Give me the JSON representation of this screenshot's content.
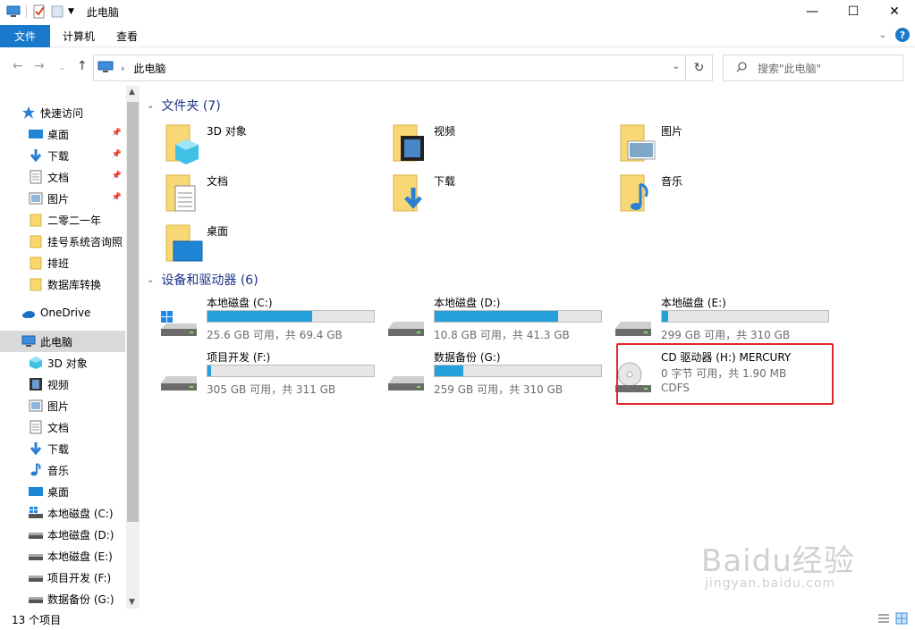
{
  "window": {
    "title": "此电脑",
    "controls": [
      "minimize-icon",
      "maximize-icon",
      "close-icon"
    ]
  },
  "ribbon": {
    "tabs": [
      {
        "label": "文件",
        "active": true
      },
      {
        "label": "计算机"
      },
      {
        "label": "查看"
      }
    ],
    "help": "?"
  },
  "address": {
    "crumb": "此电脑",
    "search_placeholder": "搜索\"此电脑\""
  },
  "sidebar": {
    "quick_access": "快速访问",
    "pinned": [
      {
        "label": "桌面",
        "icon": "desktop-icon"
      },
      {
        "label": "下载",
        "icon": "download-icon"
      },
      {
        "label": "文档",
        "icon": "document-icon"
      },
      {
        "label": "图片",
        "icon": "picture-icon"
      }
    ],
    "recent": [
      {
        "label": "二零二一年",
        "icon": "folder-icon"
      },
      {
        "label": "挂号系统咨询照",
        "icon": "folder-icon"
      },
      {
        "label": "排班",
        "icon": "folder-icon"
      },
      {
        "label": "数据库转换",
        "icon": "folder-icon"
      }
    ],
    "onedrive": "OneDrive",
    "this_pc": "此电脑",
    "pc_items": [
      {
        "label": "3D 对象",
        "icon": "3d-objects-icon"
      },
      {
        "label": "视频",
        "icon": "video-icon"
      },
      {
        "label": "图片",
        "icon": "picture-icon"
      },
      {
        "label": "文档",
        "icon": "document-icon"
      },
      {
        "label": "下载",
        "icon": "download-icon"
      },
      {
        "label": "音乐",
        "icon": "music-icon"
      },
      {
        "label": "桌面",
        "icon": "desktop-icon"
      },
      {
        "label": "本地磁盘 (C:)",
        "icon": "windows-drive-icon"
      },
      {
        "label": "本地磁盘 (D:)",
        "icon": "drive-icon"
      },
      {
        "label": "本地磁盘 (E:)",
        "icon": "drive-icon"
      },
      {
        "label": "项目开发 (F:)",
        "icon": "drive-icon"
      },
      {
        "label": "数据备份 (G:)",
        "icon": "drive-icon"
      }
    ]
  },
  "folders_group": {
    "title": "文件夹 (7)",
    "items": [
      {
        "label": "3D 对象",
        "icon": "3d-objects-folder-icon"
      },
      {
        "label": "视频",
        "icon": "video-folder-icon"
      },
      {
        "label": "图片",
        "icon": "picture-folder-icon"
      },
      {
        "label": "文档",
        "icon": "document-folder-icon"
      },
      {
        "label": "下载",
        "icon": "download-folder-icon"
      },
      {
        "label": "音乐",
        "icon": "music-folder-icon"
      },
      {
        "label": "桌面",
        "icon": "desktop-folder-icon"
      }
    ]
  },
  "drives_group": {
    "title": "设备和驱动器 (6)",
    "items": [
      {
        "label": "本地磁盘 (C:)",
        "size": "25.6 GB 可用，共 69.4 GB",
        "used_fraction": 0.63
      },
      {
        "label": "本地磁盘 (D:)",
        "size": "10.8 GB 可用，共 41.3 GB",
        "used_fraction": 0.74
      },
      {
        "label": "本地磁盘 (E:)",
        "size": "299 GB 可用，共 310 GB",
        "used_fraction": 0.035
      },
      {
        "label": "项目开发 (F:)",
        "size": "305 GB 可用，共 311 GB",
        "used_fraction": 0.02
      },
      {
        "label": "数据备份 (G:)",
        "size": "259 GB 可用，共 310 GB",
        "used_fraction": 0.17
      },
      {
        "label": "CD 驱动器 (H:) MERCURY",
        "size": "0 字节 可用，共 1.90 MB",
        "fs": "CDFS"
      }
    ]
  },
  "status": {
    "count": "13 个项目"
  },
  "watermark": {
    "brand": "Baidu经验",
    "url": "jingyan.baidu.com"
  },
  "colors": {
    "accent": "#1979ca",
    "bar_fill": "#26a0da",
    "group_title": "#1e3287",
    "highlight": "#e0262a"
  }
}
